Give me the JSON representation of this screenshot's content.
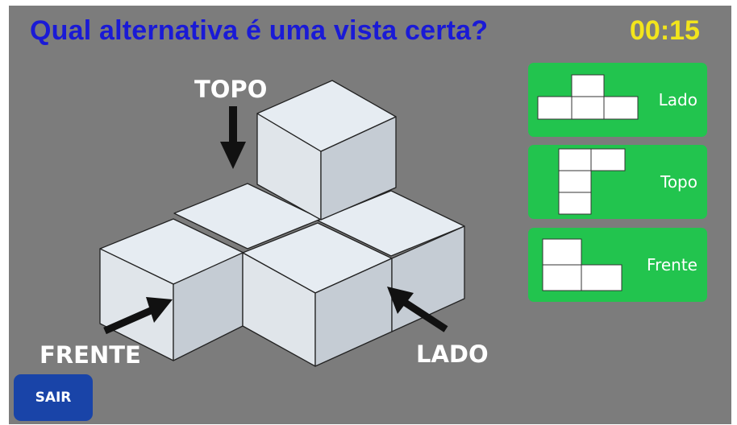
{
  "question": "Qual alternativa é uma vista certa?",
  "timer": "00:15",
  "scene": {
    "top_label": "TOPO",
    "front_label": "FRENTE",
    "side_label": "LADO"
  },
  "options": [
    {
      "label": "Lado"
    },
    {
      "label": "Topo"
    },
    {
      "label": "Frente"
    }
  ],
  "exit_label": "SAIR",
  "colors": {
    "background": "#7c7c7c",
    "question": "#1a1ad6",
    "timer": "#f2e51c",
    "option_bg": "#22c44e",
    "exit_bg": "#1944a8"
  }
}
